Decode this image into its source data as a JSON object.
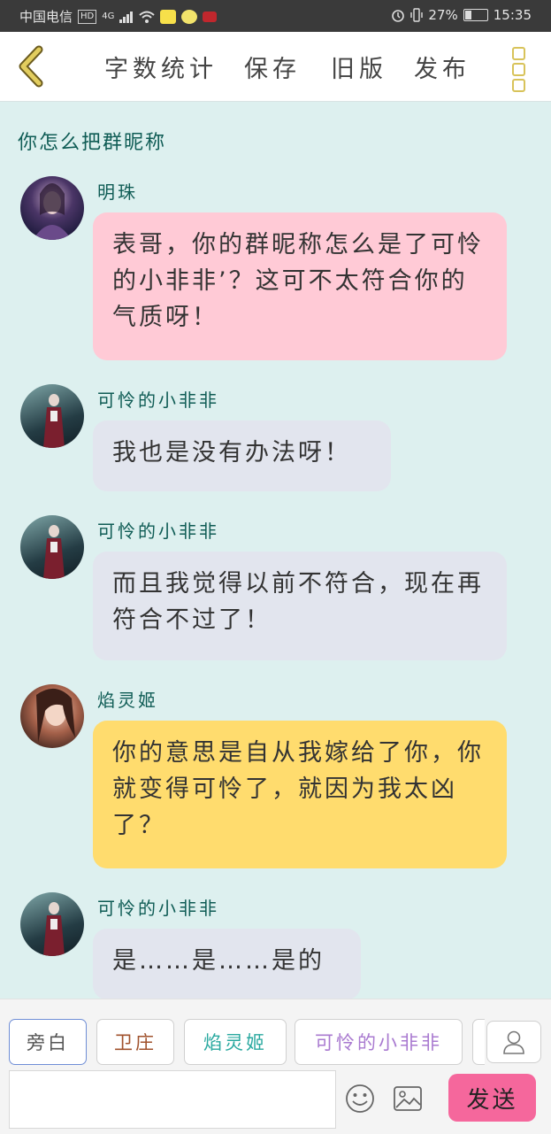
{
  "status_bar": {
    "carrier": "中国电信",
    "hd": "HD",
    "network": "4G",
    "battery": "27%",
    "battery_fraction": 0.27,
    "time": "15:35"
  },
  "toolbar": {
    "word_count": "字数统计",
    "save": "保存",
    "old_version": "旧版",
    "publish": "发布"
  },
  "chat": {
    "prompt": "你怎么把群昵称",
    "messages": [
      {
        "speaker": "明珠",
        "text": "表哥，你的群昵称怎么是了可怜的小非非’？这可不太符合你的气质呀！",
        "style": "pink"
      },
      {
        "speaker": "可怜的小非非",
        "text": "我也是没有办法呀！",
        "style": "gray"
      },
      {
        "speaker": "可怜的小非非",
        "text": "而且我觉得以前不符合，现在再符合不过了！",
        "style": "gray"
      },
      {
        "speaker": "焰灵姬",
        "text": "你的意思是自从我嫁给了你，你就变得可怜了，就因为我太凶了？",
        "style": "yellow"
      },
      {
        "speaker": "可怜的小非非",
        "text": "是……是……是的",
        "style": "gray"
      }
    ]
  },
  "characters": [
    {
      "label": "旁白",
      "color": "#555555"
    },
    {
      "label": "卫庄",
      "color": "#a0522d"
    },
    {
      "label": "焰灵姬",
      "color": "#2aa9a0"
    },
    {
      "label": "可怜的小非非",
      "color": "#a97ad0"
    }
  ],
  "input": {
    "placeholder": ""
  },
  "send_label": "发送",
  "colors": {
    "background": "#ddf0ef",
    "pink_bubble": "#ffcad6",
    "gray_bubble": "#e2e5ee",
    "yellow_bubble": "#ffdc6e",
    "send_button": "#f5679c",
    "name_text": "#0f5c55"
  }
}
